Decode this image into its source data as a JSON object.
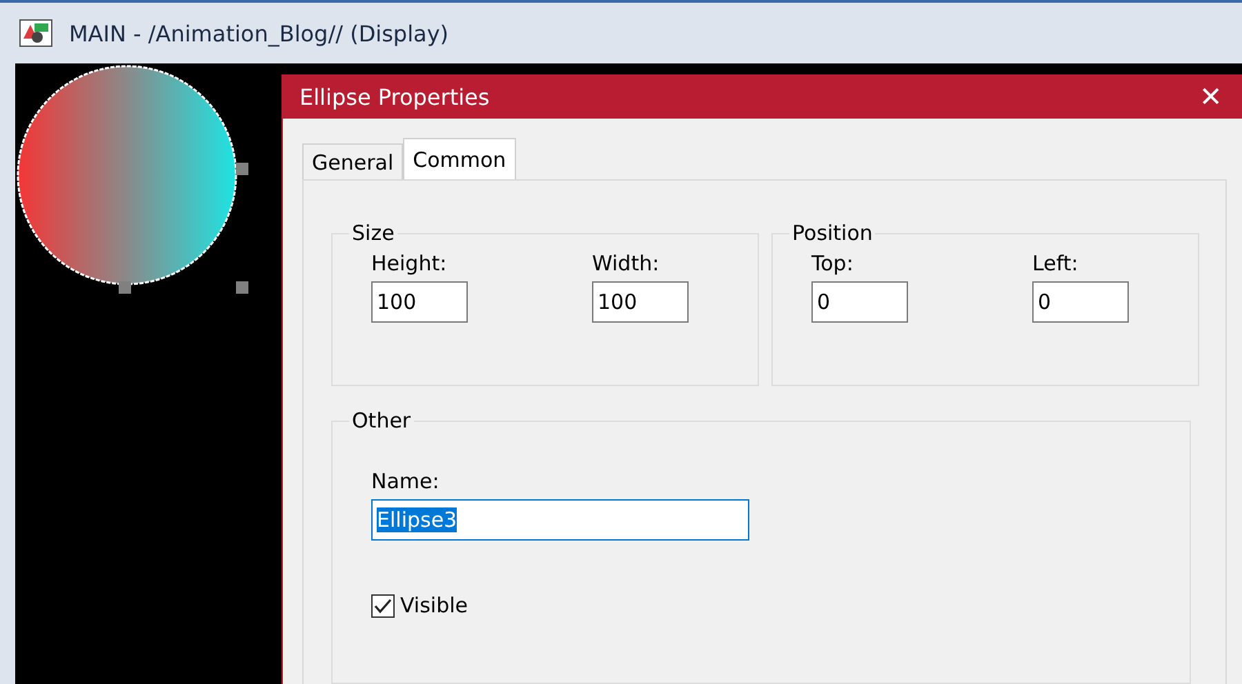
{
  "window": {
    "title": "MAIN - /Animation_Blog// (Display)"
  },
  "dialog": {
    "title": "Ellipse Properties",
    "close": "✕"
  },
  "tabs": [
    {
      "label": "General",
      "selected": false
    },
    {
      "label": "Common",
      "selected": true
    }
  ],
  "groups": [
    {
      "title": "Size",
      "fields": [
        {
          "label": "Height:",
          "value": "100"
        },
        {
          "label": "Width:",
          "value": "100"
        }
      ]
    },
    {
      "title": "Position",
      "fields": [
        {
          "label": "Top:",
          "value": "0"
        },
        {
          "label": "Left:",
          "value": "0"
        }
      ]
    }
  ],
  "other": {
    "title": "Other",
    "name_label": "Name:",
    "name_value": "Ellipse3",
    "name_selected": true,
    "visible": {
      "label": "Visible",
      "checked": true
    }
  }
}
